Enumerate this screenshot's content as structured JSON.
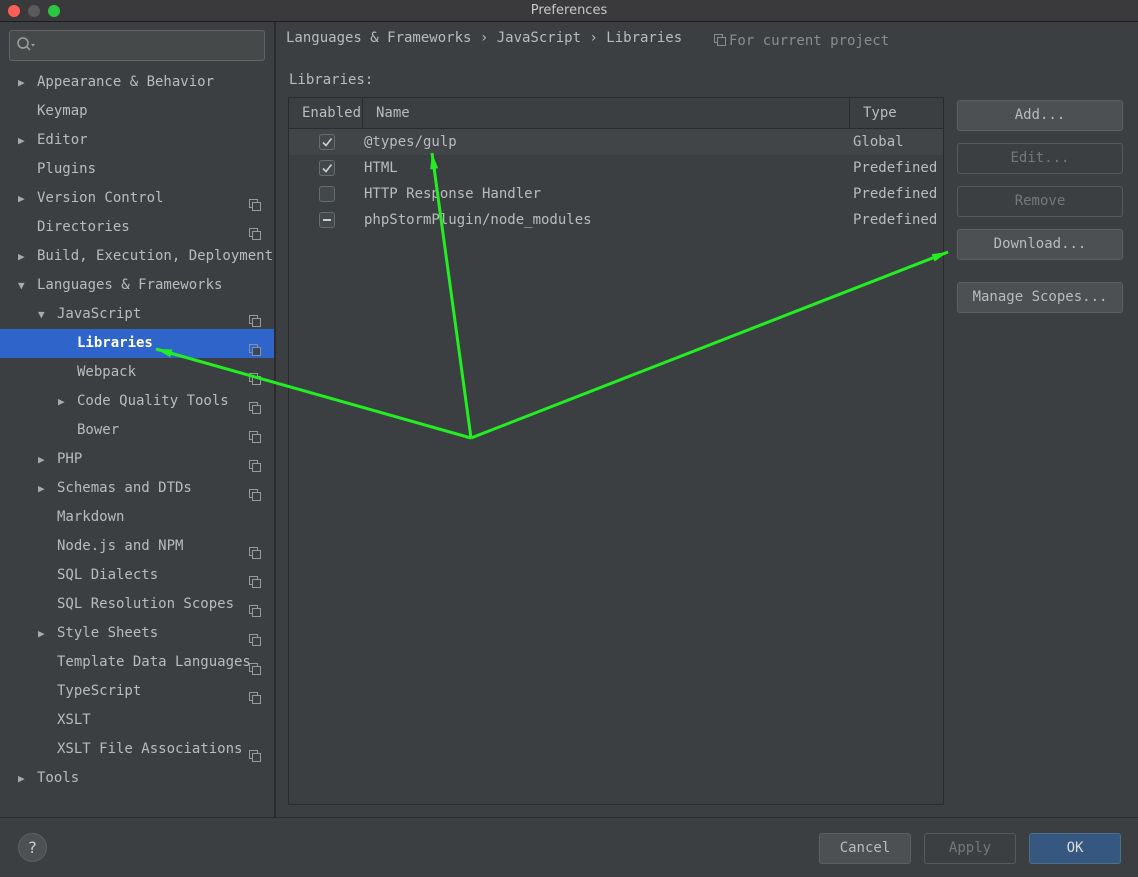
{
  "window": {
    "title": "Preferences"
  },
  "search": {
    "placeholder": ""
  },
  "sidebar": {
    "items": [
      {
        "label": "Appearance & Behavior",
        "arrow": "▶",
        "level": 0,
        "proj": false
      },
      {
        "label": "Keymap",
        "arrow": "",
        "level": 0,
        "proj": false
      },
      {
        "label": "Editor",
        "arrow": "▶",
        "level": 0,
        "proj": false
      },
      {
        "label": "Plugins",
        "arrow": "",
        "level": 0,
        "proj": false
      },
      {
        "label": "Version Control",
        "arrow": "▶",
        "level": 0,
        "proj": true
      },
      {
        "label": "Directories",
        "arrow": "",
        "level": 0,
        "proj": true
      },
      {
        "label": "Build, Execution, Deployment",
        "arrow": "▶",
        "level": 0,
        "proj": false
      },
      {
        "label": "Languages & Frameworks",
        "arrow": "▼",
        "level": 0,
        "proj": false
      },
      {
        "label": "JavaScript",
        "arrow": "▼",
        "level": 1,
        "proj": true
      },
      {
        "label": "Libraries",
        "arrow": "",
        "level": 2,
        "proj": true,
        "selected": true
      },
      {
        "label": "Webpack",
        "arrow": "",
        "level": 2,
        "proj": true
      },
      {
        "label": "Code Quality Tools",
        "arrow": "▶",
        "level": 2,
        "proj": true
      },
      {
        "label": "Bower",
        "arrow": "",
        "level": 2,
        "proj": true
      },
      {
        "label": "PHP",
        "arrow": "▶",
        "level": 1,
        "proj": true
      },
      {
        "label": "Schemas and DTDs",
        "arrow": "▶",
        "level": 1,
        "proj": true
      },
      {
        "label": "Markdown",
        "arrow": "",
        "level": 1,
        "proj": false
      },
      {
        "label": "Node.js and NPM",
        "arrow": "",
        "level": 1,
        "proj": true
      },
      {
        "label": "SQL Dialects",
        "arrow": "",
        "level": 1,
        "proj": true
      },
      {
        "label": "SQL Resolution Scopes",
        "arrow": "",
        "level": 1,
        "proj": true
      },
      {
        "label": "Style Sheets",
        "arrow": "▶",
        "level": 1,
        "proj": true
      },
      {
        "label": "Template Data Languages",
        "arrow": "",
        "level": 1,
        "proj": true
      },
      {
        "label": "TypeScript",
        "arrow": "",
        "level": 1,
        "proj": true
      },
      {
        "label": "XSLT",
        "arrow": "",
        "level": 1,
        "proj": false
      },
      {
        "label": "XSLT File Associations",
        "arrow": "",
        "level": 1,
        "proj": true
      },
      {
        "label": "Tools",
        "arrow": "▶",
        "level": 0,
        "proj": false
      }
    ]
  },
  "header": {
    "breadcrumb": "Languages & Frameworks › JavaScript › Libraries",
    "for_project": "For current project"
  },
  "libraries": {
    "label": "Libraries:",
    "columns": {
      "enabled": "Enabled",
      "name": "Name",
      "type": "Type"
    },
    "rows": [
      {
        "enabled": "checked",
        "name": "@types/gulp",
        "type": "Global",
        "selected": true
      },
      {
        "enabled": "checked",
        "name": "HTML",
        "type": "Predefined"
      },
      {
        "enabled": "unchecked",
        "name": "HTTP Response Handler",
        "type": "Predefined"
      },
      {
        "enabled": "mixed",
        "name": "phpStormPlugin/node_modules",
        "type": "Predefined"
      }
    ]
  },
  "actions": {
    "add": "Add...",
    "edit": "Edit...",
    "remove": "Remove",
    "download": "Download...",
    "manage_scopes": "Manage Scopes..."
  },
  "footer": {
    "help": "?",
    "cancel": "Cancel",
    "apply": "Apply",
    "ok": "OK"
  },
  "annotation_color": "#22ee22"
}
